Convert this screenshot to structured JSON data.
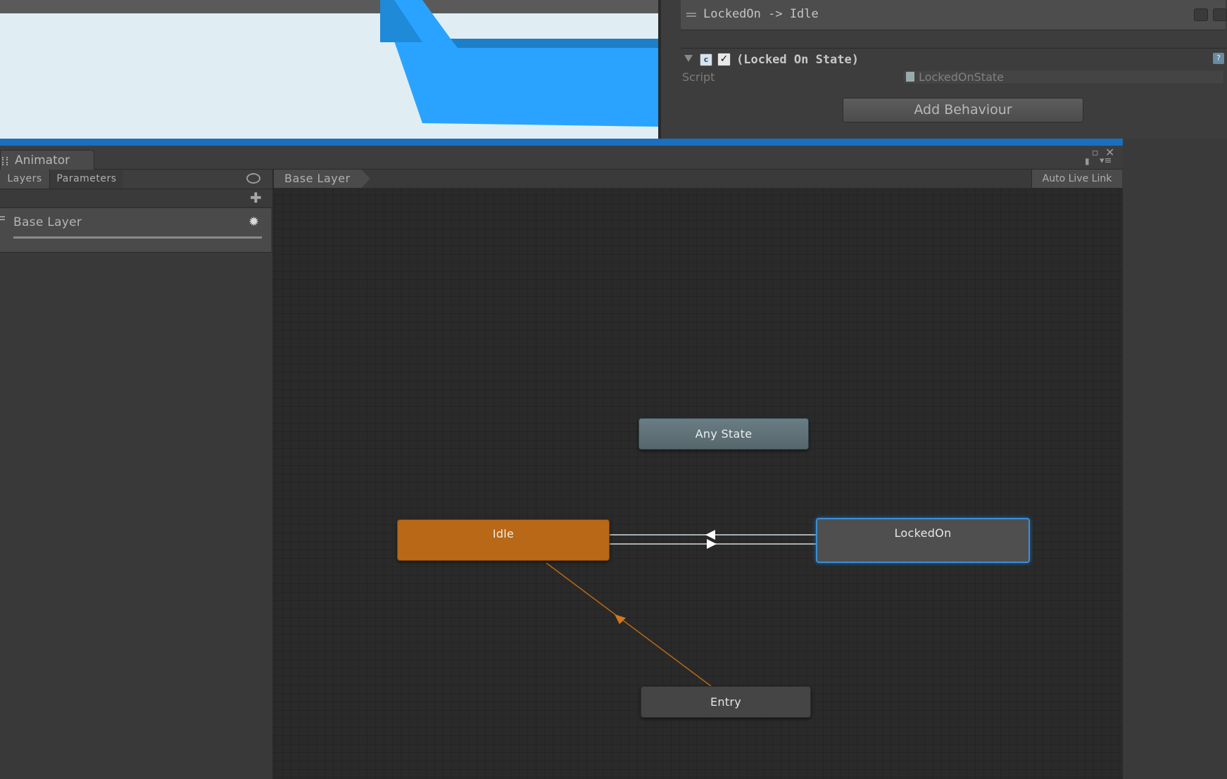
{
  "inspector": {
    "transition_title": "LockedOn -> Idle",
    "behaviour_title": "(Locked On State)",
    "script_label": "Script",
    "script_value": "LockedOnState",
    "add_behaviour_label": "Add Behaviour"
  },
  "animator": {
    "tab_label": "Animator",
    "left_tabs": [
      "Layers",
      "Parameters"
    ],
    "layers": [
      {
        "name": "Base Layer"
      }
    ],
    "breadcrumb": "Base Layer",
    "auto_live_link_label": "Auto Live Link",
    "states": {
      "any_state": "Any State",
      "idle": "Idle",
      "locked_on": "LockedOn",
      "entry": "Entry"
    },
    "transitions": [
      {
        "from": "LockedOn",
        "to": "Idle"
      },
      {
        "from": "Idle",
        "to": "LockedOn"
      },
      {
        "from": "Entry",
        "to": "Idle"
      }
    ]
  },
  "colors": {
    "default_state": "#b86816",
    "selected_border": "#3a8ed8",
    "any_state": "#5f7378",
    "accent": "#1a6fc0",
    "scene_blue": "#29a3ff"
  }
}
